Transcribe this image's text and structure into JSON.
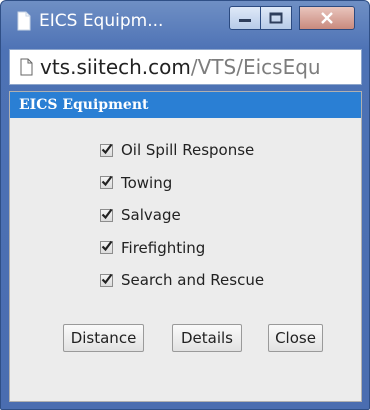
{
  "window": {
    "title": "EICS Equipm...",
    "controls": {
      "minimize": "minimize",
      "maximize": "maximize",
      "close": "close"
    }
  },
  "address_bar": {
    "host": "vts.siitech.com",
    "path": "/VTS/EicsEqu"
  },
  "panel": {
    "header": "EICS Equipment",
    "options": [
      {
        "label": "Oil Spill Response",
        "checked": true
      },
      {
        "label": "Towing",
        "checked": true
      },
      {
        "label": "Salvage",
        "checked": true
      },
      {
        "label": "Firefighting",
        "checked": true
      },
      {
        "label": "Search and Rescue",
        "checked": true
      }
    ],
    "buttons": {
      "distance": "Distance",
      "details": "Details",
      "close": "Close"
    }
  },
  "colors": {
    "titlebar": "#4d72b5",
    "panel_header": "#2a7fd4",
    "content_bg": "#ececec"
  }
}
